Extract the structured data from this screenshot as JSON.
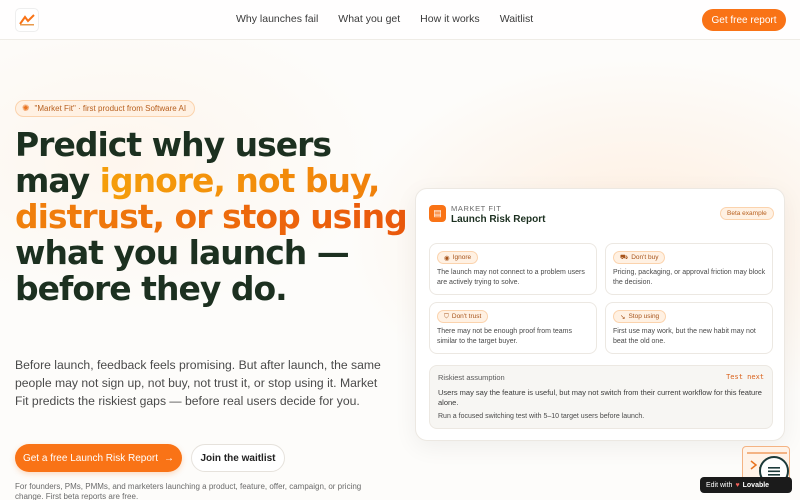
{
  "nav": {
    "logo_icon": "market-fit-logo",
    "links": [
      "Why launches fail",
      "What you get",
      "How it works",
      "Waitlist"
    ],
    "cta": "Get free report"
  },
  "hero": {
    "badge": "\"Market Fit\" · first product from Software AI",
    "headline": {
      "part1": "Predict why users may ",
      "accent1": "ignore, not buy, distrust, or stop using",
      "part2": " what you launch — before they do."
    },
    "subtitle": "Before launch, feedback feels promising. But after launch, the same people may not sign up, not buy, not trust it, or stop using it. Market Fit predicts the riskiest gaps — before real users decide for you.",
    "primary_button": "Get a free Launch Risk Report",
    "secondary_button": "Join the waitlist",
    "footnote": "For founders, PMs, PMMs, and marketers launching a product, feature, offer, campaign, or pricing change. First beta reports are free."
  },
  "card": {
    "eyebrow": "MARKET FIT",
    "title": "Launch Risk Report",
    "tag": "Beta example",
    "risks": [
      {
        "label": "Ignore",
        "icon": "eye-icon",
        "text": "The launch may not connect to a problem users are actively trying to solve."
      },
      {
        "label": "Don't buy",
        "icon": "cart-icon",
        "text": "Pricing, packaging, or approval friction may block the decision."
      },
      {
        "label": "Don't trust",
        "icon": "shield-icon",
        "text": "There may not be enough proof from teams similar to the target buyer."
      },
      {
        "label": "Stop using",
        "icon": "trend-down-icon",
        "text": "First use may work, but the new habit may not beat the old one."
      }
    ],
    "assumption": {
      "label": "Riskiest assumption",
      "next": "Test next",
      "text": "Users may say the feature is useful, but may not switch from their current workflow for this feature alone.",
      "action": "Run a focused switching test with 5–10 target users before launch."
    }
  },
  "edit_badge": {
    "prefix": "Edit with",
    "brand": "Lovable"
  },
  "colors": {
    "accent": "#f97316",
    "headline": "#1c3020"
  }
}
